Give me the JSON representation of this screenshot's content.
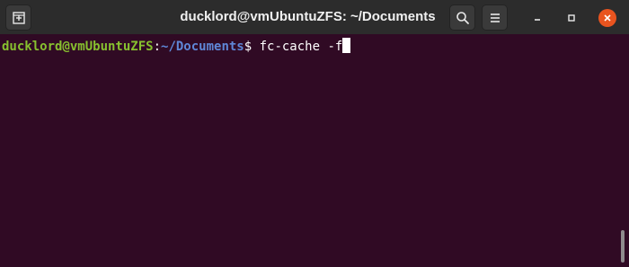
{
  "window": {
    "title": "ducklord@vmUbuntuZFS: ~/Documents",
    "icons": {
      "new_tab": "new-tab-icon",
      "search": "search-icon",
      "menu": "hamburger-menu-icon",
      "minimize": "minimize-icon",
      "maximize": "maximize-icon",
      "close": "close-icon"
    }
  },
  "terminal": {
    "user_host": "ducklord@vmUbuntuZFS",
    "separator": ":",
    "path": "~/Documents",
    "prompt_symbol": "$ ",
    "command": "fc-cache -f"
  },
  "colors": {
    "background": "#300a24",
    "user_host": "#87c02f",
    "path": "#5f87d7",
    "close_button": "#e9541f",
    "titlebar": "#2c2c2c"
  }
}
